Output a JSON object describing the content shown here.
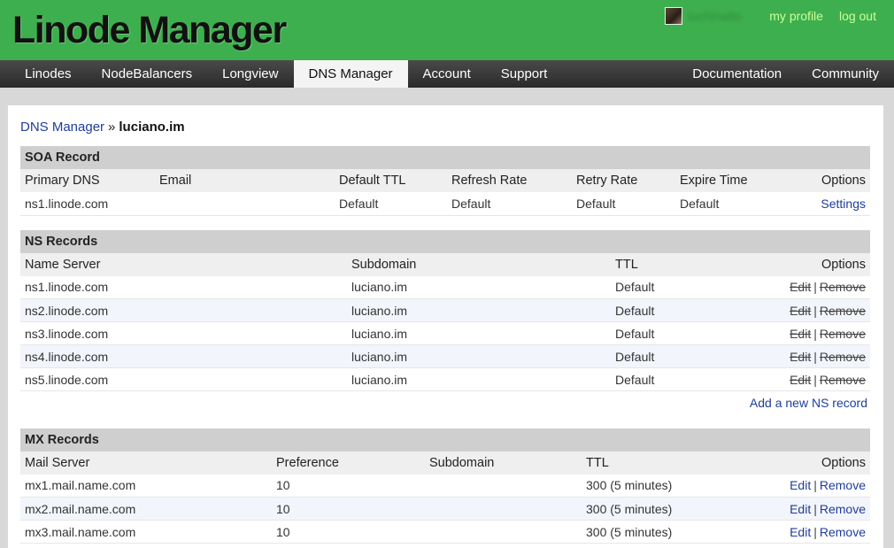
{
  "header": {
    "logo": "Linode Manager",
    "username": "luchinatto",
    "my_profile": "my profile",
    "log_out": "log out"
  },
  "nav": {
    "left": [
      "Linodes",
      "NodeBalancers",
      "Longview",
      "DNS Manager",
      "Account",
      "Support"
    ],
    "right": [
      "Documentation",
      "Community"
    ],
    "active": "DNS Manager"
  },
  "breadcrumb": {
    "parent": "DNS Manager",
    "separator": "»",
    "current": "luciano.im"
  },
  "soa": {
    "title": "SOA Record",
    "columns": [
      "Primary DNS",
      "Email",
      "Default TTL",
      "Refresh Rate",
      "Retry Rate",
      "Expire Time",
      "Options"
    ],
    "row": {
      "primary_dns": "ns1.linode.com",
      "email": "",
      "default_ttl": "Default",
      "refresh_rate": "Default",
      "retry_rate": "Default",
      "expire_time": "Default",
      "option": "Settings"
    }
  },
  "ns": {
    "title": "NS Records",
    "columns": [
      "Name Server",
      "Subdomain",
      "TTL",
      "Options"
    ],
    "rows": [
      {
        "server": "ns1.linode.com",
        "subdomain": "luciano.im",
        "ttl": "Default"
      },
      {
        "server": "ns2.linode.com",
        "subdomain": "luciano.im",
        "ttl": "Default"
      },
      {
        "server": "ns3.linode.com",
        "subdomain": "luciano.im",
        "ttl": "Default"
      },
      {
        "server": "ns4.linode.com",
        "subdomain": "luciano.im",
        "ttl": "Default"
      },
      {
        "server": "ns5.linode.com",
        "subdomain": "luciano.im",
        "ttl": "Default"
      }
    ],
    "edit": "Edit",
    "remove": "Remove",
    "sep": "|",
    "add": "Add a new NS record"
  },
  "mx": {
    "title": "MX Records",
    "columns": [
      "Mail Server",
      "Preference",
      "Subdomain",
      "TTL",
      "Options"
    ],
    "rows": [
      {
        "server": "mx1.mail.name.com",
        "preference": "10",
        "subdomain": "",
        "ttl": "300 (5 minutes)"
      },
      {
        "server": "mx2.mail.name.com",
        "preference": "10",
        "subdomain": "",
        "ttl": "300 (5 minutes)"
      },
      {
        "server": "mx3.mail.name.com",
        "preference": "10",
        "subdomain": "",
        "ttl": "300 (5 minutes)"
      }
    ],
    "edit": "Edit",
    "remove": "Remove",
    "sep": "|"
  },
  "colors": {
    "header_green": "#3eaf4e",
    "link_blue": "#1f3d9c",
    "nav_dark": "#333333"
  }
}
